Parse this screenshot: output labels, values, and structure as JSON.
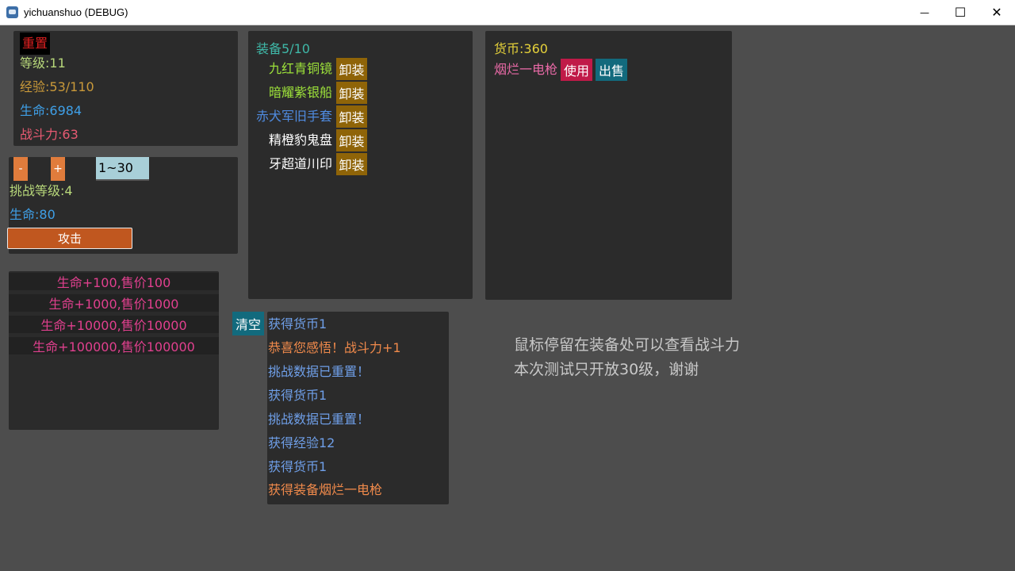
{
  "window": {
    "title": "yichuanshuo (DEBUG)",
    "minimize": "—",
    "maximize": "☐",
    "close": "✕"
  },
  "stats": {
    "reset": "重置",
    "level": "等级:11",
    "exp": "经验:53/110",
    "hp": "生命:6984",
    "power": "战斗力:63"
  },
  "challenge": {
    "minus": "-",
    "plus": "+",
    "range": "1~30",
    "level": "挑战等级:4",
    "hp": "生命:80",
    "attack": "攻击"
  },
  "shop": {
    "items": [
      "生命+100,售价100",
      "生命+1000,售价1000",
      "生命+10000,售价10000",
      "生命+100000,售价100000"
    ]
  },
  "equipment": {
    "header": "装备5/10",
    "unequip_label": "卸装",
    "items": [
      {
        "name": "九红青铜镜",
        "color": "#9de23a"
      },
      {
        "name": "暗耀紫银船",
        "color": "#9de23a"
      },
      {
        "name": "赤犬军旧手套",
        "color": "#4f8be0"
      },
      {
        "name": "精橙豹鬼盘",
        "color": "#ffffff"
      },
      {
        "name": "牙超道川印",
        "color": "#ffffff"
      }
    ]
  },
  "inventory": {
    "currency": "货币:360",
    "item": "烟烂一电枪",
    "use": "使用",
    "sell": "出售"
  },
  "log": {
    "clear": "清空",
    "lines": [
      {
        "text": "获得货币1",
        "color": "#6f9fe8"
      },
      {
        "text": "恭喜您感悟！战斗力+1",
        "color": "#f08a4b"
      },
      {
        "text": "挑战数据已重置！",
        "color": "#6f9fe8"
      },
      {
        "text": "获得货币1",
        "color": "#6f9fe8"
      },
      {
        "text": "挑战数据已重置！",
        "color": "#6f9fe8"
      },
      {
        "text": "获得经验12",
        "color": "#6f9fe8"
      },
      {
        "text": "获得货币1",
        "color": "#6f9fe8"
      },
      {
        "text": "获得装备烟烂一电枪",
        "color": "#f08a4b"
      }
    ]
  },
  "hint": {
    "line1": "鼠标停留在装备处可以查看战斗力",
    "line2": "本次测试只开放30级，谢谢"
  },
  "colors": {
    "background": "#4d4d4d",
    "panel": "#2b2b2b",
    "gold_button": "#8f6408",
    "attack_button": "#c0571f",
    "shop_text": "#e0408e"
  }
}
